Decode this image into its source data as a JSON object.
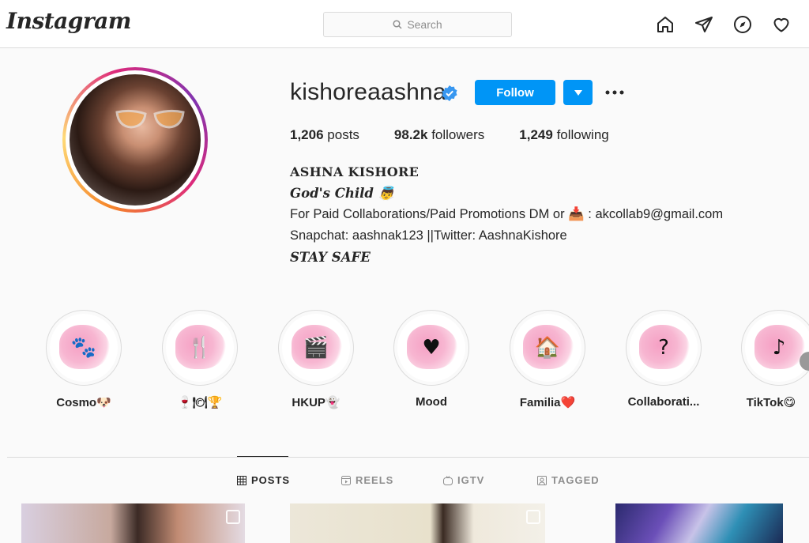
{
  "nav": {
    "logo": "Instagram",
    "search_placeholder": "Search",
    "icons": [
      "home-icon",
      "direct-message-icon",
      "explore-compass-icon",
      "heart-activity-icon"
    ]
  },
  "profile": {
    "username": "kishoreaashna",
    "verified": true,
    "follow_label": "Follow",
    "stats": {
      "posts_count": "1,206",
      "posts_label": "posts",
      "followers_count": "98.2k",
      "followers_label": "followers",
      "following_count": "1,249",
      "following_label": "following"
    },
    "full_name": "ASHNA KISHORE",
    "bio": {
      "line1": "God's Child 👼",
      "line2_prefix": "For Paid Collaborations/Paid Promotions DM or 📥 : ",
      "line2_email": "akcollab9@gmail.com",
      "line3": "Snapchat: aashnak123 ||Twitter: AashnaKishore",
      "line4": "STAY SAFE"
    }
  },
  "highlights": [
    {
      "label": "Cosmo🐶",
      "icon": "paw-prints-icon",
      "glyph": "🐾"
    },
    {
      "label": "🍷🍽🏆",
      "icon": "fork-knife-icon",
      "glyph": "🍴"
    },
    {
      "label": "HKUP👻",
      "icon": "clapperboard-icon",
      "glyph": "🎬"
    },
    {
      "label": "Mood",
      "icon": "heart-speech-bubble-icon",
      "glyph": "♥"
    },
    {
      "label": "Familia❤️",
      "icon": "heart-house-icon",
      "glyph": "🏠"
    },
    {
      "label": "Collaborati...",
      "icon": "question-mark-icon",
      "glyph": "?"
    },
    {
      "label": "TikTok😋",
      "icon": "music-note-icon",
      "glyph": "♪"
    }
  ],
  "tabs": [
    {
      "label": "POSTS",
      "icon": "grid-icon",
      "active": true
    },
    {
      "label": "REELS",
      "icon": "reels-icon",
      "active": false
    },
    {
      "label": "IGTV",
      "icon": "igtv-icon",
      "active": false
    },
    {
      "label": "TAGGED",
      "icon": "tagged-icon",
      "active": false
    }
  ],
  "colors": {
    "accent": "#0095f6",
    "verified": "#3897f0",
    "text": "#262626",
    "muted": "#8e8e8e",
    "highlight_splash": "#f5a0c4"
  }
}
